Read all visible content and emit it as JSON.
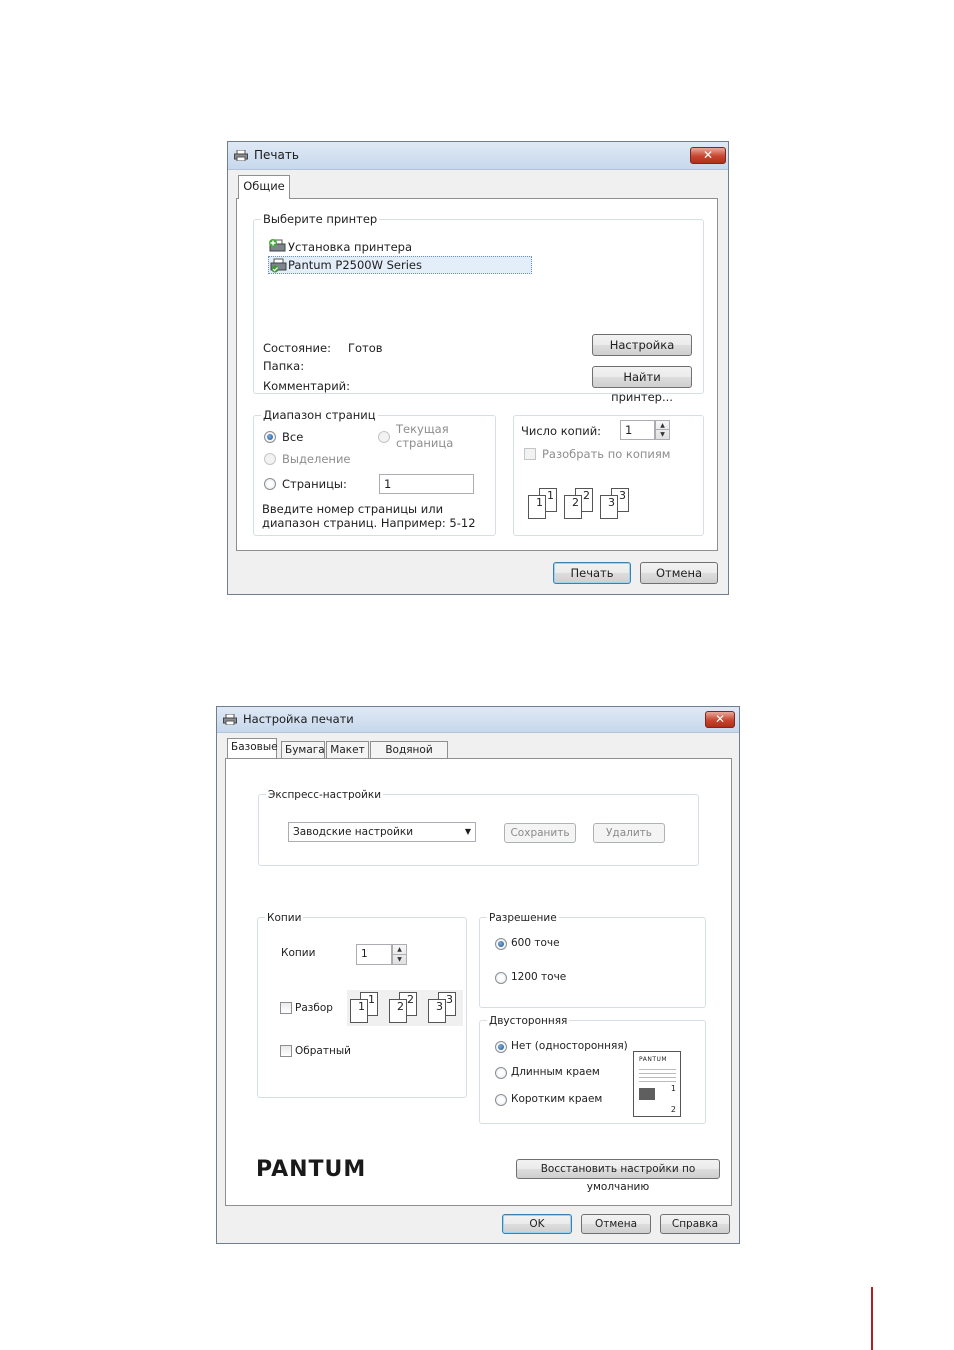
{
  "print_dialog": {
    "title": "Печать",
    "close_glyph": "✕",
    "tab_general": "Общие",
    "select_printer_group": "Выберите принтер",
    "printers": [
      "Установка принтера",
      "Pantum P2500W Series"
    ],
    "status_label": "Состояние:",
    "status_value": "Готов",
    "folder_label": "Папка:",
    "comment_label": "Комментарий:",
    "setup_button": "Настройка",
    "find_printer_button": "Найти принтер...",
    "page_range_group": "Диапазон страниц",
    "range_all": "Все",
    "range_selection": "Выделение",
    "range_current": "Текущая страница",
    "range_pages": "Страницы:",
    "range_pages_value": "1",
    "range_hint": "Введите номер страницы или диапазон страниц.  Например: 5-12",
    "copies_label": "Число копий:",
    "copies_value": "1",
    "collate_label": "Разобрать по копиям",
    "collate_pages": [
      "1",
      "1",
      "2",
      "2",
      "3",
      "3"
    ],
    "print_button": "Печать",
    "cancel_button": "Отмена"
  },
  "settings_dialog": {
    "title": "Настройка печати",
    "close_glyph": "✕",
    "tabs": [
      "Базовые",
      "Бумага",
      "Макет",
      "Водяной знак"
    ],
    "express_group": "Экспресс-настройки",
    "express_value": "Заводские настройки",
    "save_button": "Сохранить",
    "delete_button": "Удалить",
    "copies_group": "Копии",
    "copies_label": "Копии",
    "copies_value": "1",
    "collate_label": "Разбор",
    "reverse_label": "Обратный",
    "collate_pages": [
      "1",
      "1",
      "2",
      "2",
      "3",
      "3"
    ],
    "resolution_group": "Разрешение",
    "res_600": "600 точе",
    "res_1200": "1200 точе",
    "duplex_group": "Двусторонняя",
    "duplex_none": "Нет (односторонняя)",
    "duplex_long": "Длинным краем",
    "duplex_short": "Коротким краем",
    "duplex_preview_brand": "PANTUM",
    "duplex_preview_pages": [
      "1",
      "2"
    ],
    "brand_logo": "PANTUM",
    "restore_button": "Восстановить настройки по умолчанию",
    "ok_button": "OK",
    "cancel_button": "Отмена",
    "help_button": "Справка"
  }
}
